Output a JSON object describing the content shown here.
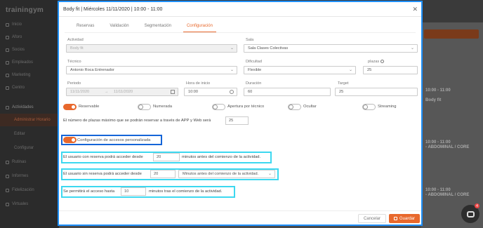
{
  "app": {
    "logo": "trainingym",
    "nav": [
      {
        "label": "Inicio"
      },
      {
        "label": "Aforo"
      },
      {
        "label": "Socios"
      },
      {
        "label": "Empleados"
      },
      {
        "label": "Marketing"
      },
      {
        "label": "Centro"
      },
      {
        "label": "Actividades"
      },
      {
        "label": "Administrar Horario"
      },
      {
        "label": "Editar"
      },
      {
        "label": "Configurar"
      },
      {
        "label": "Rutinas"
      },
      {
        "label": "Informes"
      },
      {
        "label": "Fidelización"
      },
      {
        "label": "Virtuales"
      }
    ],
    "right_panel": {
      "card1_time": "10:00 - 11:00",
      "card1_title": "Body fit",
      "card2_time": "10:00 - 11:00",
      "card2_title": "- ABDOMINAL / CORE",
      "card3_time": "10:00 - 11:00",
      "card3_title": "- ABDOMINAL / CORE"
    },
    "chat_badge": "4"
  },
  "modal": {
    "title": "Body fit | Miércoles 11/11/2020 | 10:00 - 11:00",
    "tabs": [
      "Reservas",
      "Validación",
      "Segmentación",
      "Configuración"
    ],
    "active_tab": 3,
    "actividad": {
      "label": "Actividad",
      "value": "Body fit"
    },
    "sala": {
      "label": "Sala",
      "value": "Sala Clases Colectivas"
    },
    "tecnico": {
      "label": "Técnico",
      "value": "Antonio Roca Entrenador"
    },
    "dificultad": {
      "label": "Dificultad",
      "value": "Flexible"
    },
    "plazas": {
      "label": "plazas",
      "value": "25"
    },
    "periodo": {
      "label": "Periodo",
      "from": "11/11/2020",
      "arrow": "→",
      "to": "11/11/2020"
    },
    "hora_inicio": {
      "label": "Hora de inicio",
      "value": "10:00"
    },
    "duracion": {
      "label": "Duración",
      "value": "60"
    },
    "target": {
      "label": "Target",
      "value": "25"
    },
    "toggles": [
      {
        "label": "Reservable",
        "on": true
      },
      {
        "label": "Numerada",
        "on": false
      },
      {
        "label": "Apertura por técnico",
        "on": false
      },
      {
        "label": "Ocultar",
        "on": false
      },
      {
        "label": "Streaming",
        "on": false
      }
    ],
    "max_plazas_text": "El número de plazas máximo que se podrán reservar a través de APP y Web será",
    "max_plazas_value": "25",
    "config_accesos": {
      "label": "Configuración de accesos personalizada",
      "on": true
    },
    "row_con_reserva": {
      "label": "El usuario con reserva podrá acceder desde",
      "value": "20",
      "suffix": "minutos antes del comienzo de la actividad."
    },
    "row_sin_reserva": {
      "label": "El usuario sin reserva podrá acceder desde",
      "value": "20",
      "suffix": "Minutos antes del comienzo de la actividad."
    },
    "row_acceso_hasta": {
      "label": "Se permitirá el acceso hasta",
      "value": "10",
      "suffix": "minutos tras el comienzo de la actividad."
    },
    "buttons": {
      "cancel": "Cancelar",
      "save": "Guardar"
    }
  }
}
